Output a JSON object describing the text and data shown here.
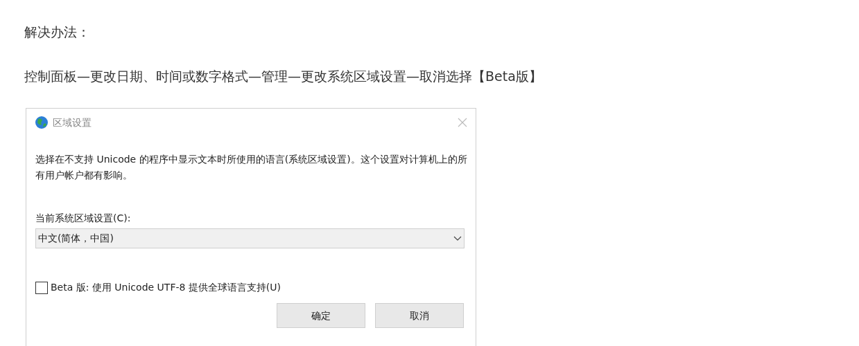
{
  "article": {
    "heading": "解决办法：",
    "path": "控制面板—更改日期、时间或数字格式—管理—更改系统区域设置—取消选择【Beta版】"
  },
  "dialog": {
    "title": "区域设置",
    "description": "选择在不支持 Unicode 的程序中显示文本时所使用的语言(系统区域设置)。这个设置对计算机上的所有用户帐户都有影响。",
    "locale_label": "当前系统区域设置(C):",
    "locale_value": "中文(简体，中国)",
    "beta_checkbox": {
      "label": "Beta 版: 使用 Unicode UTF-8 提供全球语言支持(U)",
      "checked": false
    },
    "buttons": [
      "确定",
      "取消"
    ]
  }
}
